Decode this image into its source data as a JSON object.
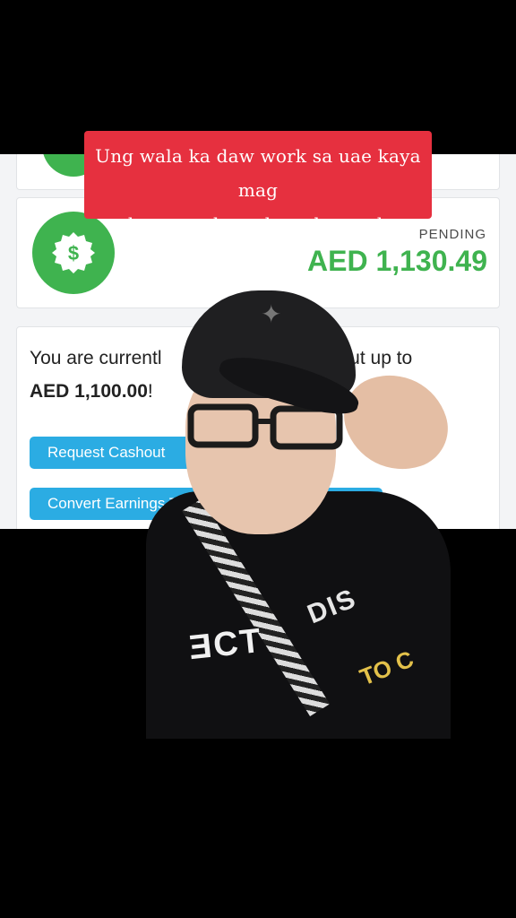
{
  "caption": {
    "line1": "Ung wala ka daw work sa uae kaya mag",
    "line2": "hanap nalang daw ako work"
  },
  "balance": {
    "pending_label": "PENDING",
    "pending_amount": "AED 1,130.49",
    "icon": "dollar-badge-icon"
  },
  "cashout": {
    "text_prefix": "You are currentl",
    "text_suffix": "sh out up to",
    "amount": "AED 1,100.00",
    "punct": "!",
    "request_button": "Request Cashout",
    "convert_button": "Convert Earnings To"
  },
  "overlay": {
    "shirt_text_main": "ƎCT",
    "shirt_text_top": "DIS",
    "shirt_text_accent": "TO C"
  },
  "colors": {
    "accent_green": "#3fb34f",
    "button_blue": "#2bace3",
    "caption_red": "#e6303f"
  }
}
